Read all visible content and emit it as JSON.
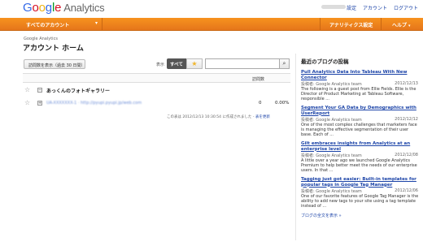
{
  "header": {
    "logo": {
      "g1": "G",
      "g2": "o",
      "g3": "o",
      "g4": "g",
      "g5": "l",
      "g6": "e",
      "product": "Analytics"
    },
    "links": {
      "settings": "設定",
      "account": "アカウント",
      "logout": "ログアウト"
    }
  },
  "nav": {
    "all_accounts": "すべてのアカウント",
    "caret": "▾",
    "analytics_settings": "アナリティクス設定",
    "help": "ヘルプ",
    "help_caret": "▾"
  },
  "page": {
    "breadcrumb": "Google Analytics",
    "title": "アカウント ホーム"
  },
  "toolbar": {
    "date_range": "訪問数を表示（過去 30 日間）",
    "display_label": "表示",
    "all_button": "すべて",
    "star_glyph": "★",
    "search_placeholder": "",
    "search_glyph": "⌕"
  },
  "table": {
    "col_visits": "訪問数",
    "star_glyph": "☆",
    "account": {
      "toggle": "−",
      "name": "あっくんのフォトギャラリー"
    },
    "property": {
      "toggle": "+",
      "name": "UA-XXXXXXX-1 · http://pyupi.pyupi.jp/web.com",
      "visits": "0",
      "percent": "0.00%"
    }
  },
  "generated_note": {
    "text": "この表は 2012/12/13 10:30:54 に作成されました - ",
    "refresh": "表を更新"
  },
  "blog": {
    "heading": "最近のブログの投稿",
    "posts": [
      {
        "title": "Pull Analytics Data Into Tableau With New Connector",
        "author": "投稿者: Google Analytics team",
        "date": "2012/12/13",
        "body": "The following is a guest post from Ellie Fields. Ellie is the Director of Product Marketing at Tableau Software, responsible ..."
      },
      {
        "title": "Segment Your GA Data by Demographics with UserReport",
        "author": "投稿者: Google Analytics team",
        "date": "2012/12/12",
        "body": "One of the most complex challenges that marketers face is managing the effective segmentation of their user base. Each of ..."
      },
      {
        "title": "Gilt embraces insights from Analytics at an enterprise level",
        "author": "投稿者: Google Analytics team",
        "date": "2012/12/08",
        "body": "A little over a year ago we launched Google Analytics Premium to help better meet the needs of our enterprise users. In that ..."
      },
      {
        "title": "Tagging just got easier: Built-in templates for popular tags in Google Tag Manager",
        "author": "投稿者: Google Analytics team",
        "date": "2012/12/06",
        "body": "One of our favorite features of Google Tag Manager is the ability to add new tags to your site using a tag template instead of ..."
      }
    ],
    "view_all": "ブログの全文を表示 »"
  },
  "colors": {
    "accent_orange": "#f7921e",
    "link_blue": "#1c44a8"
  }
}
